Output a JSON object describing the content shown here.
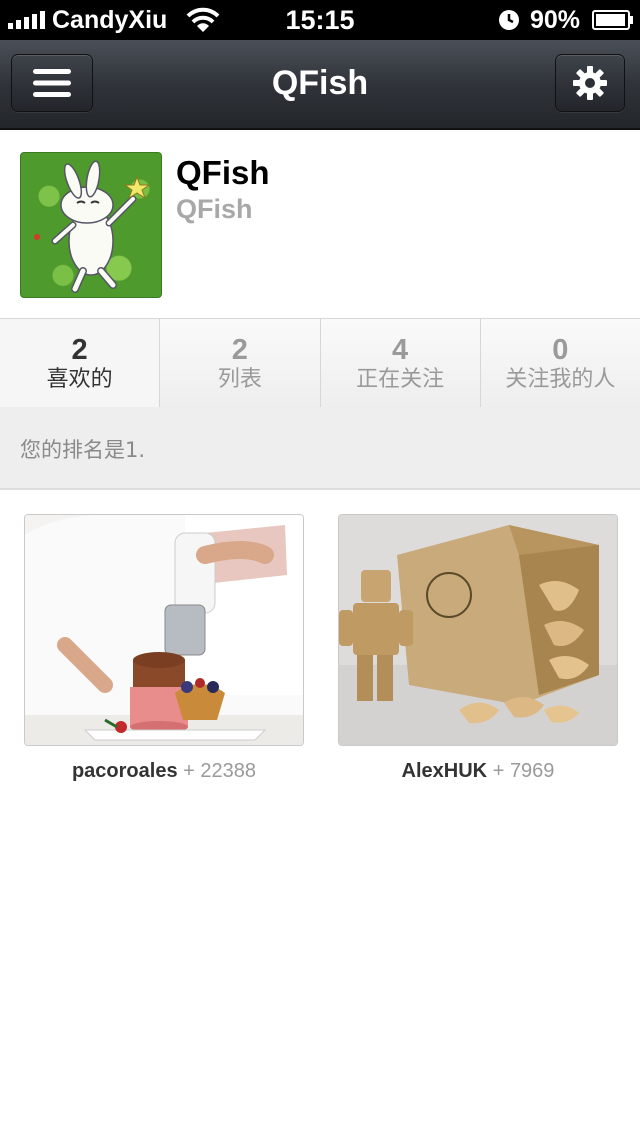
{
  "status_bar": {
    "carrier": "CandyXiu",
    "time": "15:15",
    "battery": "90%"
  },
  "nav": {
    "title": "QFish",
    "left_icon": "menu-icon",
    "right_icon": "gear-icon"
  },
  "profile": {
    "name": "QFish",
    "handle": "QFish"
  },
  "stats": [
    {
      "count": "2",
      "label": "喜欢的"
    },
    {
      "count": "2",
      "label": "列表"
    },
    {
      "count": "4",
      "label": "正在关注"
    },
    {
      "count": "0",
      "label": "关注我的人"
    }
  ],
  "rank_text": "您的排名是1.",
  "items": [
    {
      "user": "pacoroales",
      "plus": "+",
      "count": "22388"
    },
    {
      "user": "AlexHUK",
      "plus": "+",
      "count": "7969"
    }
  ]
}
